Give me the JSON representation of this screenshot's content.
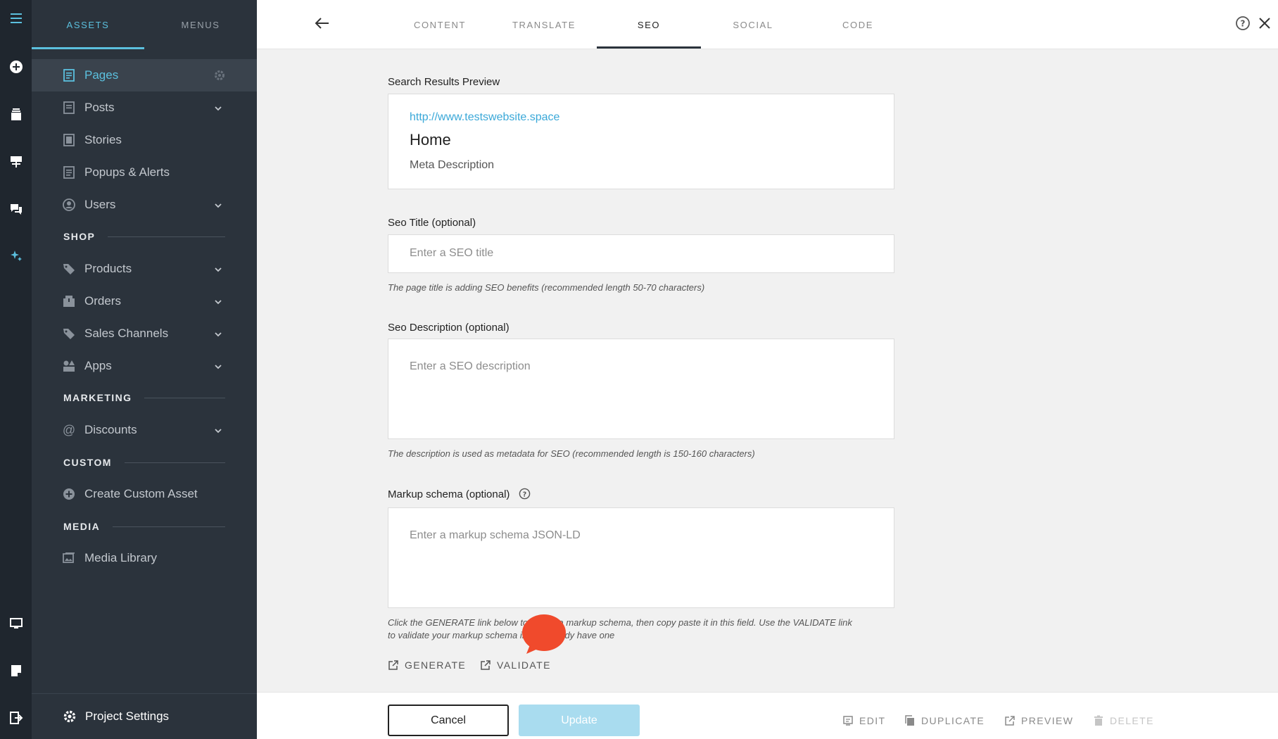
{
  "panel": {
    "tabs": [
      "ASSETS",
      "MENUS"
    ],
    "items": {
      "pages": "Pages",
      "posts": "Posts",
      "stories": "Stories",
      "popups": "Popups & Alerts",
      "users": "Users",
      "products": "Products",
      "orders": "Orders",
      "sales_channels": "Sales Channels",
      "apps": "Apps",
      "discounts": "Discounts",
      "create_custom": "Create Custom Asset",
      "media_library": "Media Library"
    },
    "sections": {
      "shop": "SHOP",
      "marketing": "MARKETING",
      "custom": "CUSTOM",
      "media": "MEDIA"
    },
    "project_settings": "Project Settings"
  },
  "topbar": {
    "tabs": [
      "CONTENT",
      "TRANSLATE",
      "SEO",
      "SOCIAL",
      "CODE"
    ],
    "active_tab": "SEO"
  },
  "form": {
    "preview_label": "Search Results Preview",
    "preview_url": "http://www.testswebsite.space",
    "preview_title": "Home",
    "preview_description": "Meta Description",
    "seo_title_label": "Seo Title (optional)",
    "seo_title_placeholder": "Enter a SEO title",
    "seo_title_hint": "The page title is adding SEO benefits (recommended length 50-70 characters)",
    "seo_desc_label": "Seo Description (optional)",
    "seo_desc_placeholder": "Enter a SEO description",
    "seo_desc_hint": "The description is used as metadata for SEO (recommended length is 150-160 characters)",
    "markup_label": "Markup schema (optional)",
    "markup_placeholder": "Enter a markup schema JSON-LD",
    "markup_hint_line1": "Click the GENERATE link below to create a markup schema, then copy paste it in this field. Use the VALIDATE link",
    "markup_hint_line2": "to validate your markup schema if you already have one",
    "generate": "GENERATE",
    "validate": "VALIDATE"
  },
  "bottombar": {
    "cancel": "Cancel",
    "update": "Update",
    "edit": "EDIT",
    "duplicate": "DUPLICATE",
    "preview": "PREVIEW",
    "delete": "DELETE"
  },
  "colors": {
    "accent": "#5bc0de",
    "rail": "#1f262e",
    "panel": "#2b333c",
    "update_button": "#a9dcef",
    "bubble": "#f04a2c"
  }
}
